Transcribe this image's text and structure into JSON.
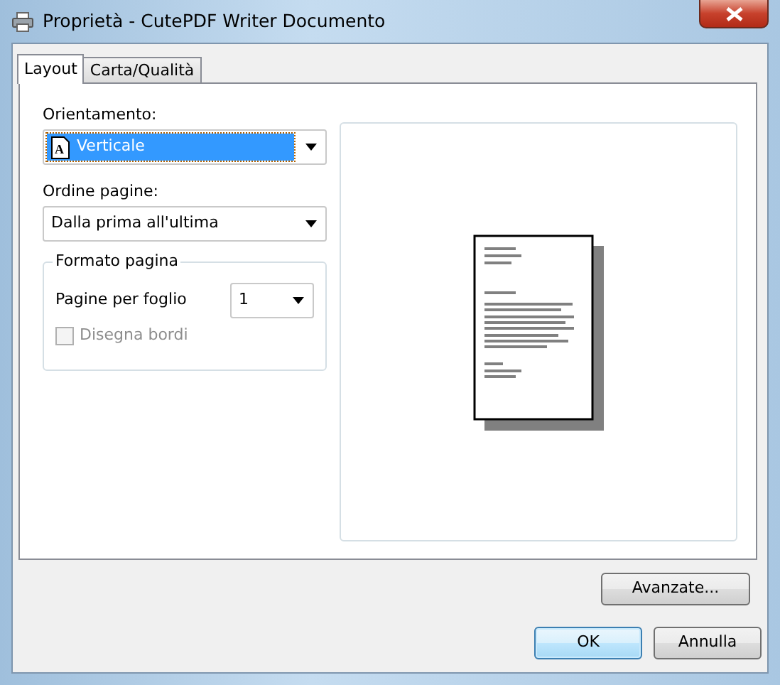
{
  "window": {
    "title": "Proprietà - CutePDF Writer Documento"
  },
  "tabs": [
    {
      "label": "Layout",
      "selected": true
    },
    {
      "label": "Carta/Qualità",
      "selected": false
    }
  ],
  "orientation": {
    "label": "Orientamento:",
    "value": "Verticale",
    "icon_letter": "A",
    "focused": true
  },
  "page_order": {
    "label": "Ordine pagine:",
    "value": "Dalla prima all'ultima"
  },
  "page_format": {
    "title": "Formato pagina",
    "pages_per_sheet": {
      "label": "Pagine per foglio",
      "value": "1"
    },
    "draw_borders": {
      "label": "Disegna bordi",
      "checked": false,
      "disabled": true
    }
  },
  "advanced_button": "Avanzate...",
  "buttons": [
    {
      "label": "OK",
      "default": true
    },
    {
      "label": "Annulla",
      "default": false
    }
  ]
}
